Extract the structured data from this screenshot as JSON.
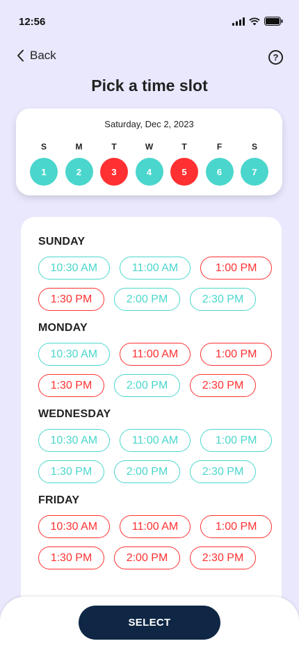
{
  "status": {
    "time": "12:56"
  },
  "nav": {
    "back_label": "Back",
    "help_symbol": "?"
  },
  "title": "Pick a time slot",
  "calendar": {
    "date_label": "Saturday, Dec 2, 2023",
    "days": [
      {
        "letter": "S",
        "number": "1",
        "state": "available"
      },
      {
        "letter": "M",
        "number": "2",
        "state": "available"
      },
      {
        "letter": "T",
        "number": "3",
        "state": "unavailable"
      },
      {
        "letter": "W",
        "number": "4",
        "state": "available"
      },
      {
        "letter": "T",
        "number": "5",
        "state": "unavailable"
      },
      {
        "letter": "F",
        "number": "6",
        "state": "available"
      },
      {
        "letter": "S",
        "number": "7",
        "state": "available"
      }
    ]
  },
  "schedule": [
    {
      "day": "SUNDAY",
      "slots": [
        {
          "time": "10:30 AM",
          "state": "available"
        },
        {
          "time": "11:00 AM",
          "state": "available"
        },
        {
          "time": "1:00 PM",
          "state": "unavailable"
        },
        {
          "time": "1:30 PM",
          "state": "unavailable"
        },
        {
          "time": "2:00 PM",
          "state": "available"
        },
        {
          "time": "2:30 PM",
          "state": "available"
        }
      ]
    },
    {
      "day": "MONDAY",
      "slots": [
        {
          "time": "10:30 AM",
          "state": "available"
        },
        {
          "time": "11:00 AM",
          "state": "unavailable"
        },
        {
          "time": "1:00 PM",
          "state": "unavailable"
        },
        {
          "time": "1:30 PM",
          "state": "unavailable"
        },
        {
          "time": "2:00 PM",
          "state": "available"
        },
        {
          "time": "2:30 PM",
          "state": "unavailable"
        }
      ]
    },
    {
      "day": "WEDNESDAY",
      "slots": [
        {
          "time": "10:30 AM",
          "state": "available"
        },
        {
          "time": "11:00 AM",
          "state": "available"
        },
        {
          "time": "1:00 PM",
          "state": "available"
        },
        {
          "time": "1:30 PM",
          "state": "available"
        },
        {
          "time": "2:00 PM",
          "state": "available"
        },
        {
          "time": "2:30 PM",
          "state": "available"
        }
      ]
    },
    {
      "day": "FRIDAY",
      "slots": [
        {
          "time": "10:30 AM",
          "state": "unavailable"
        },
        {
          "time": "11:00 AM",
          "state": "unavailable"
        },
        {
          "time": "1:00 PM",
          "state": "unavailable"
        },
        {
          "time": "1:30 PM",
          "state": "unavailable"
        },
        {
          "time": "2:00 PM",
          "state": "unavailable"
        },
        {
          "time": "2:30 PM",
          "state": "unavailable"
        }
      ]
    }
  ],
  "colors": {
    "available": "#4ad6cc",
    "unavailable": "#ff3031",
    "primary_button": "#0f2745",
    "background": "#e9e8fd"
  },
  "footer": {
    "select_label": "SELECT"
  }
}
